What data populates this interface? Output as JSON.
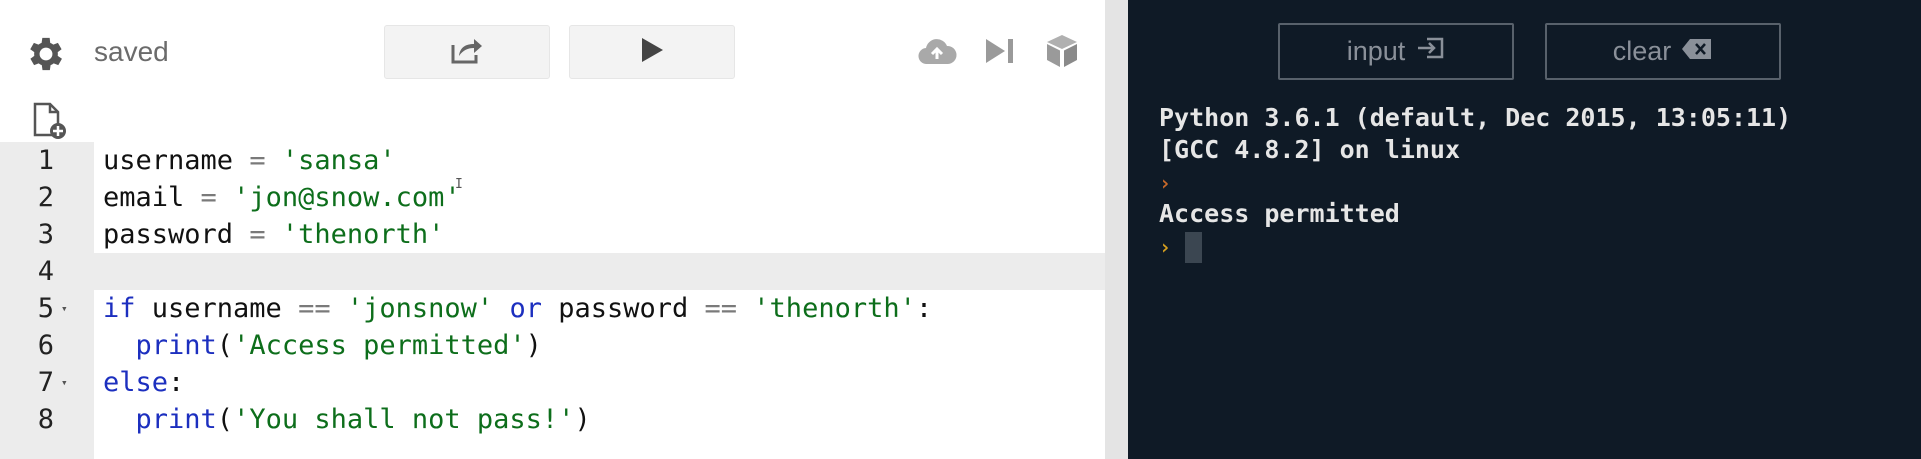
{
  "editor": {
    "status": "saved",
    "code_lines": [
      {
        "num": "1",
        "fold": "",
        "active": false,
        "tokens": [
          {
            "t": "username ",
            "c": ""
          },
          {
            "t": "=",
            "c": "op"
          },
          {
            "t": " ",
            "c": ""
          },
          {
            "t": "'sansa'",
            "c": "str"
          }
        ]
      },
      {
        "num": "2",
        "fold": "",
        "active": false,
        "tokens": [
          {
            "t": "email ",
            "c": ""
          },
          {
            "t": "=",
            "c": "op"
          },
          {
            "t": " ",
            "c": ""
          },
          {
            "t": "'jon@snow.com'",
            "c": "str"
          }
        ]
      },
      {
        "num": "3",
        "fold": "",
        "active": false,
        "tokens": [
          {
            "t": "password ",
            "c": ""
          },
          {
            "t": "=",
            "c": "op"
          },
          {
            "t": " ",
            "c": ""
          },
          {
            "t": "'thenorth'",
            "c": "str"
          }
        ]
      },
      {
        "num": "4",
        "fold": "",
        "active": true,
        "tokens": []
      },
      {
        "num": "5",
        "fold": "▾",
        "active": false,
        "tokens": [
          {
            "t": "if",
            "c": "kw"
          },
          {
            "t": " username ",
            "c": ""
          },
          {
            "t": "==",
            "c": "op"
          },
          {
            "t": " ",
            "c": ""
          },
          {
            "t": "'jonsnow'",
            "c": "str"
          },
          {
            "t": " ",
            "c": ""
          },
          {
            "t": "or",
            "c": "kw"
          },
          {
            "t": " password ",
            "c": ""
          },
          {
            "t": "==",
            "c": "op"
          },
          {
            "t": " ",
            "c": ""
          },
          {
            "t": "'thenorth'",
            "c": "str"
          },
          {
            "t": ":",
            "c": ""
          }
        ]
      },
      {
        "num": "6",
        "fold": "",
        "active": false,
        "tokens": [
          {
            "t": "  ",
            "c": ""
          },
          {
            "t": "print",
            "c": "kw"
          },
          {
            "t": "(",
            "c": ""
          },
          {
            "t": "'Access permitted'",
            "c": "str"
          },
          {
            "t": ")",
            "c": ""
          }
        ]
      },
      {
        "num": "7",
        "fold": "▾",
        "active": false,
        "tokens": [
          {
            "t": "else",
            "c": "kw"
          },
          {
            "t": ":",
            "c": ""
          }
        ]
      },
      {
        "num": "8",
        "fold": "",
        "active": false,
        "tokens": [
          {
            "t": "  ",
            "c": ""
          },
          {
            "t": "print",
            "c": "kw"
          },
          {
            "t": "(",
            "c": ""
          },
          {
            "t": "'You shall not pass!'",
            "c": "str"
          },
          {
            "t": ")",
            "c": ""
          }
        ]
      }
    ]
  },
  "toolbar": {
    "settings_icon": "gear-icon",
    "share_icon": "share-icon",
    "run_icon": "play-icon",
    "cloud_icon": "cloud-upload-icon",
    "step_icon": "step-forward-icon",
    "package_icon": "package-icon",
    "new_file_icon": "new-file-icon"
  },
  "console": {
    "input_label": "input",
    "clear_label": "clear",
    "output_lines": [
      "Python 3.6.1 (default, Dec 2015, 13:05:11)",
      "[GCC 4.8.2] on linux"
    ],
    "program_output": "Access permitted",
    "prompt_glyph": "›"
  },
  "colors": {
    "console_bg": "#0f1a26",
    "keyword": "#1c2fbf",
    "string": "#0d6e1b",
    "prompt": "#c9692a",
    "prompt_active": "#d7a01f"
  }
}
